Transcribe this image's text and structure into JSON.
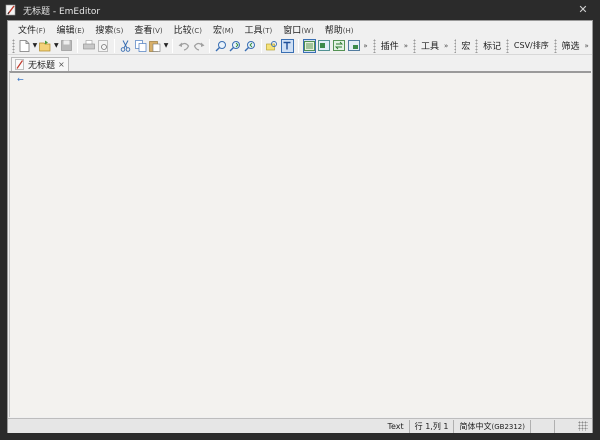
{
  "window": {
    "title": "无标题 - EmEditor",
    "close_label": "✕"
  },
  "menu": [
    {
      "label": "文件",
      "accel": "(F)"
    },
    {
      "label": "编辑",
      "accel": "(E)"
    },
    {
      "label": "搜索",
      "accel": "(S)"
    },
    {
      "label": "查看",
      "accel": "(V)"
    },
    {
      "label": "比较",
      "accel": "(C)"
    },
    {
      "label": "宏",
      "accel": "(M)"
    },
    {
      "label": "工具",
      "accel": "(T)"
    },
    {
      "label": "窗口",
      "accel": "(W)"
    },
    {
      "label": "帮助",
      "accel": "(H)"
    }
  ],
  "toolbar": {
    "overflow_glyph": "»",
    "plugins_label": "插件",
    "tools_label": "工具",
    "macros_label": "宏",
    "bookmarks_label": "标记",
    "csv_label": "CSV/排序",
    "filter_label": "筛选"
  },
  "tabs": [
    {
      "label": "无标题",
      "close": "×",
      "active": true
    }
  ],
  "editor": {
    "line_marker": "←"
  },
  "status": {
    "mode": "Text",
    "position": "行 1,列 1",
    "encoding_main": "简体中文",
    "encoding_code": "(GB2312)"
  },
  "colors": {
    "title_bar": "#2b2b2b",
    "frame": "#f0f0f0",
    "editor_bg": "#f3f2ef",
    "accent": "#3b78c9"
  }
}
